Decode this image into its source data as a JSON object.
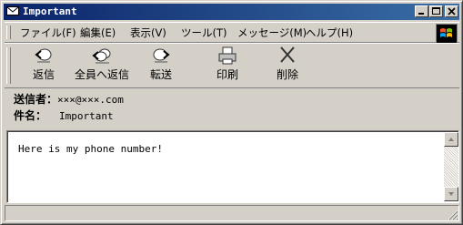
{
  "window": {
    "title": "Important",
    "title_color": "#0a246a"
  },
  "menu": {
    "items": [
      "ファイル(F)",
      "編集(E)",
      "表示(V)",
      "ツール(T)",
      "メッセージ(M)",
      "ヘルプ(H)"
    ]
  },
  "toolbar": {
    "reply": "返信",
    "reply_all": "全員へ返信",
    "forward": "転送",
    "print": "印刷",
    "delete": "削除"
  },
  "headers": {
    "from_label": "送信者：",
    "from_value": "×××@×××.com",
    "subject_label": "件名：",
    "subject_value": "Important"
  },
  "message": {
    "body": "Here is my phone number!"
  },
  "icons": [
    "envelope-icon",
    "minimize-icon",
    "maximize-icon",
    "close-icon",
    "windows-logo-icon",
    "reply-icon",
    "reply-all-icon",
    "forward-icon",
    "print-icon",
    "delete-icon",
    "scroll-up-icon",
    "scroll-down-icon",
    "size-grip-icon"
  ]
}
